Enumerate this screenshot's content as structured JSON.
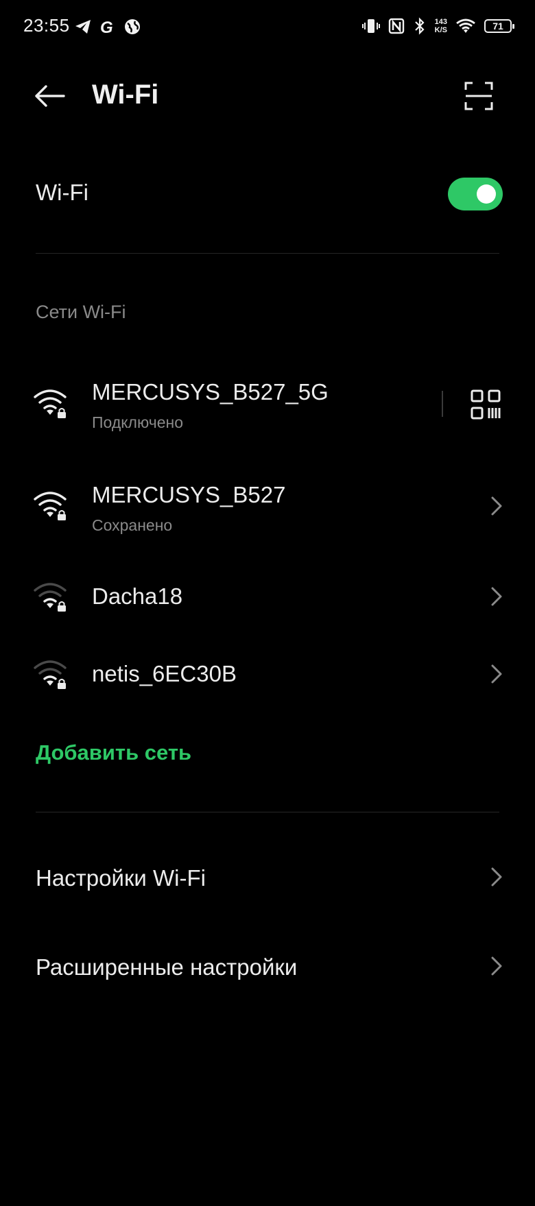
{
  "status_bar": {
    "time": "23:55",
    "net_speed_value": "143",
    "net_speed_unit": "K/S",
    "battery": "71",
    "left_icons": [
      "telegram-icon",
      "g-app-icon",
      "globe-icon"
    ],
    "right_icons": [
      "vibrate-icon",
      "nfc-icon",
      "bluetooth-icon",
      "wifi-signal-icon",
      "battery-icon"
    ]
  },
  "header": {
    "title": "Wi-Fi"
  },
  "wifi_toggle": {
    "label": "Wi-Fi",
    "enabled": true
  },
  "networks_section": {
    "title": "Сети Wi-Fi",
    "networks": [
      {
        "name": "MERCUSYS_B527_5G",
        "status": "Подключено",
        "signal": "full",
        "locked": true,
        "action": "qr-code-icon"
      },
      {
        "name": "MERCUSYS_B527",
        "status": "Сохранено",
        "signal": "full",
        "locked": true,
        "action": "chevron-right-icon"
      },
      {
        "name": "Dacha18",
        "status": "",
        "signal": "weak",
        "locked": true,
        "action": "chevron-right-icon"
      },
      {
        "name": "netis_6EC30B",
        "status": "",
        "signal": "weak",
        "locked": true,
        "action": "chevron-right-icon"
      }
    ],
    "add_network": "Добавить сеть"
  },
  "settings": {
    "wifi_settings": "Настройки Wi-Fi",
    "advanced_settings": "Расширенные настройки"
  },
  "colors": {
    "accent": "#2ec866",
    "background": "#000000",
    "text_primary": "#ececec",
    "text_secondary": "#8a8a8a"
  }
}
